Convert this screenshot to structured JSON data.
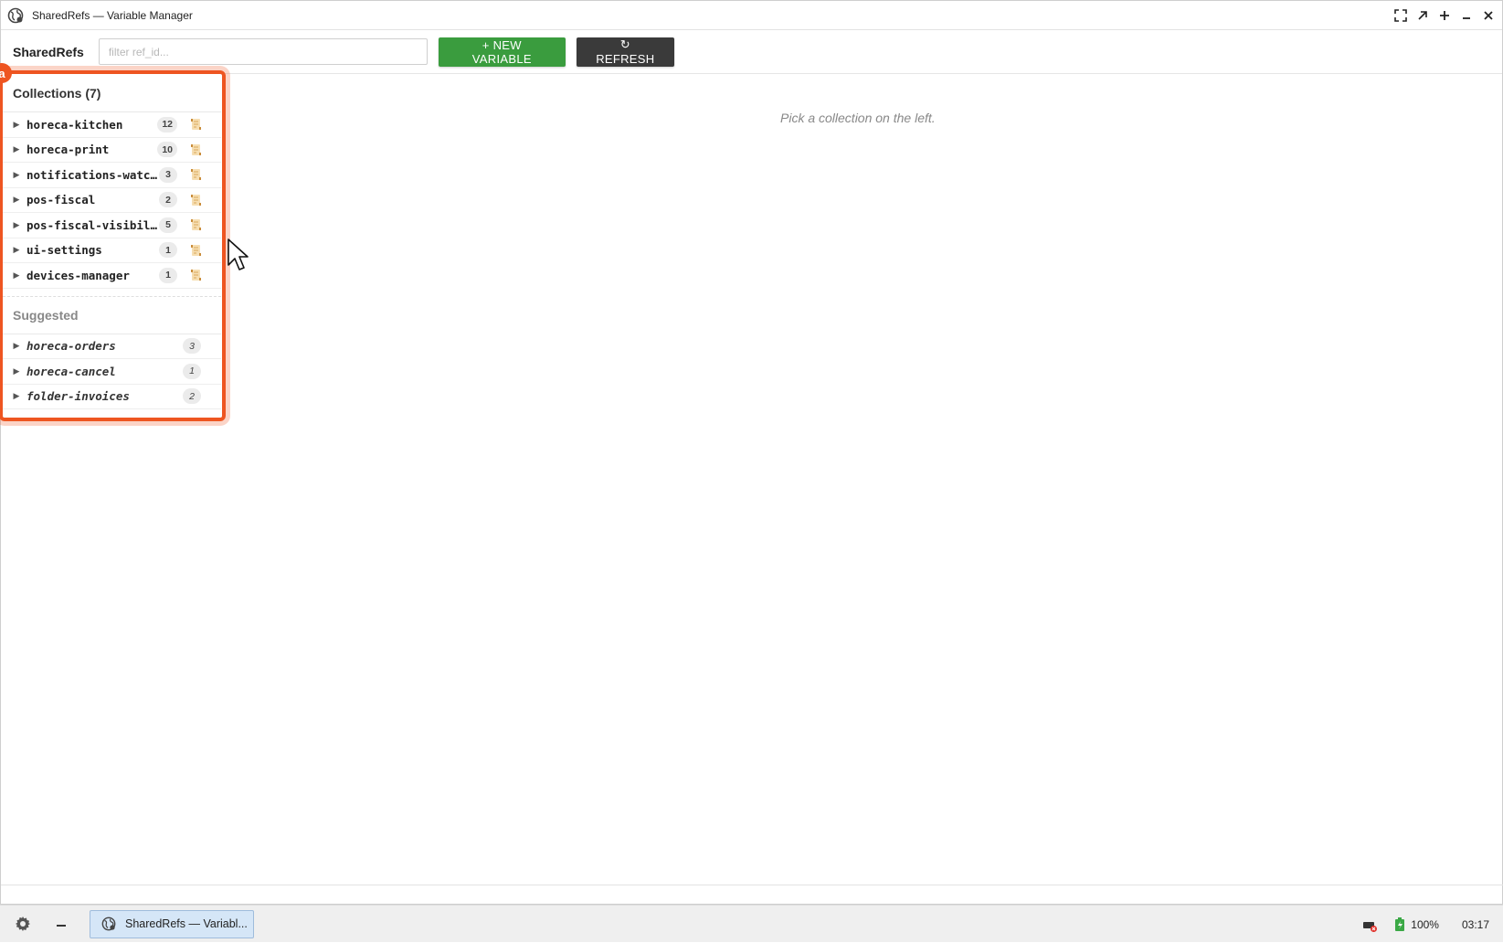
{
  "window": {
    "title": "SharedRefs — Variable Manager",
    "controls": [
      "fullscreen-icon",
      "restore-icon",
      "maximize-icon",
      "minimize-icon",
      "close-icon"
    ]
  },
  "toolbar": {
    "brand": "SharedRefs",
    "filter_placeholder": "filter ref_id...",
    "new_label": "+ NEW VARIABLE",
    "refresh_label": "↻ REFRESH",
    "colors": {
      "new": "#3a9c3e",
      "refresh": "#3a3a3a"
    }
  },
  "sidebar": {
    "highlight_badge": "a",
    "highlight_color": "#ee5521",
    "collections_title": "Collections (7)",
    "collections": [
      {
        "name": "horeca-kitchen",
        "count": "12"
      },
      {
        "name": "horeca-print",
        "count": "10"
      },
      {
        "name": "notifications-watch…",
        "count": "3"
      },
      {
        "name": "pos-fiscal",
        "count": "2"
      },
      {
        "name": "pos-fiscal-visibili…",
        "count": "5"
      },
      {
        "name": "ui-settings",
        "count": "1"
      },
      {
        "name": "devices-manager",
        "count": "1"
      }
    ],
    "suggested_title": "Suggested",
    "suggested": [
      {
        "name": "horeca-orders",
        "count": "3"
      },
      {
        "name": "horeca-cancel",
        "count": "1"
      },
      {
        "name": "folder-invoices",
        "count": "2"
      }
    ]
  },
  "main": {
    "empty_message": "Pick a collection on the left."
  },
  "taskbar": {
    "task_label": "SharedRefs — Variabl...",
    "battery": "100%",
    "clock": "03:17"
  }
}
